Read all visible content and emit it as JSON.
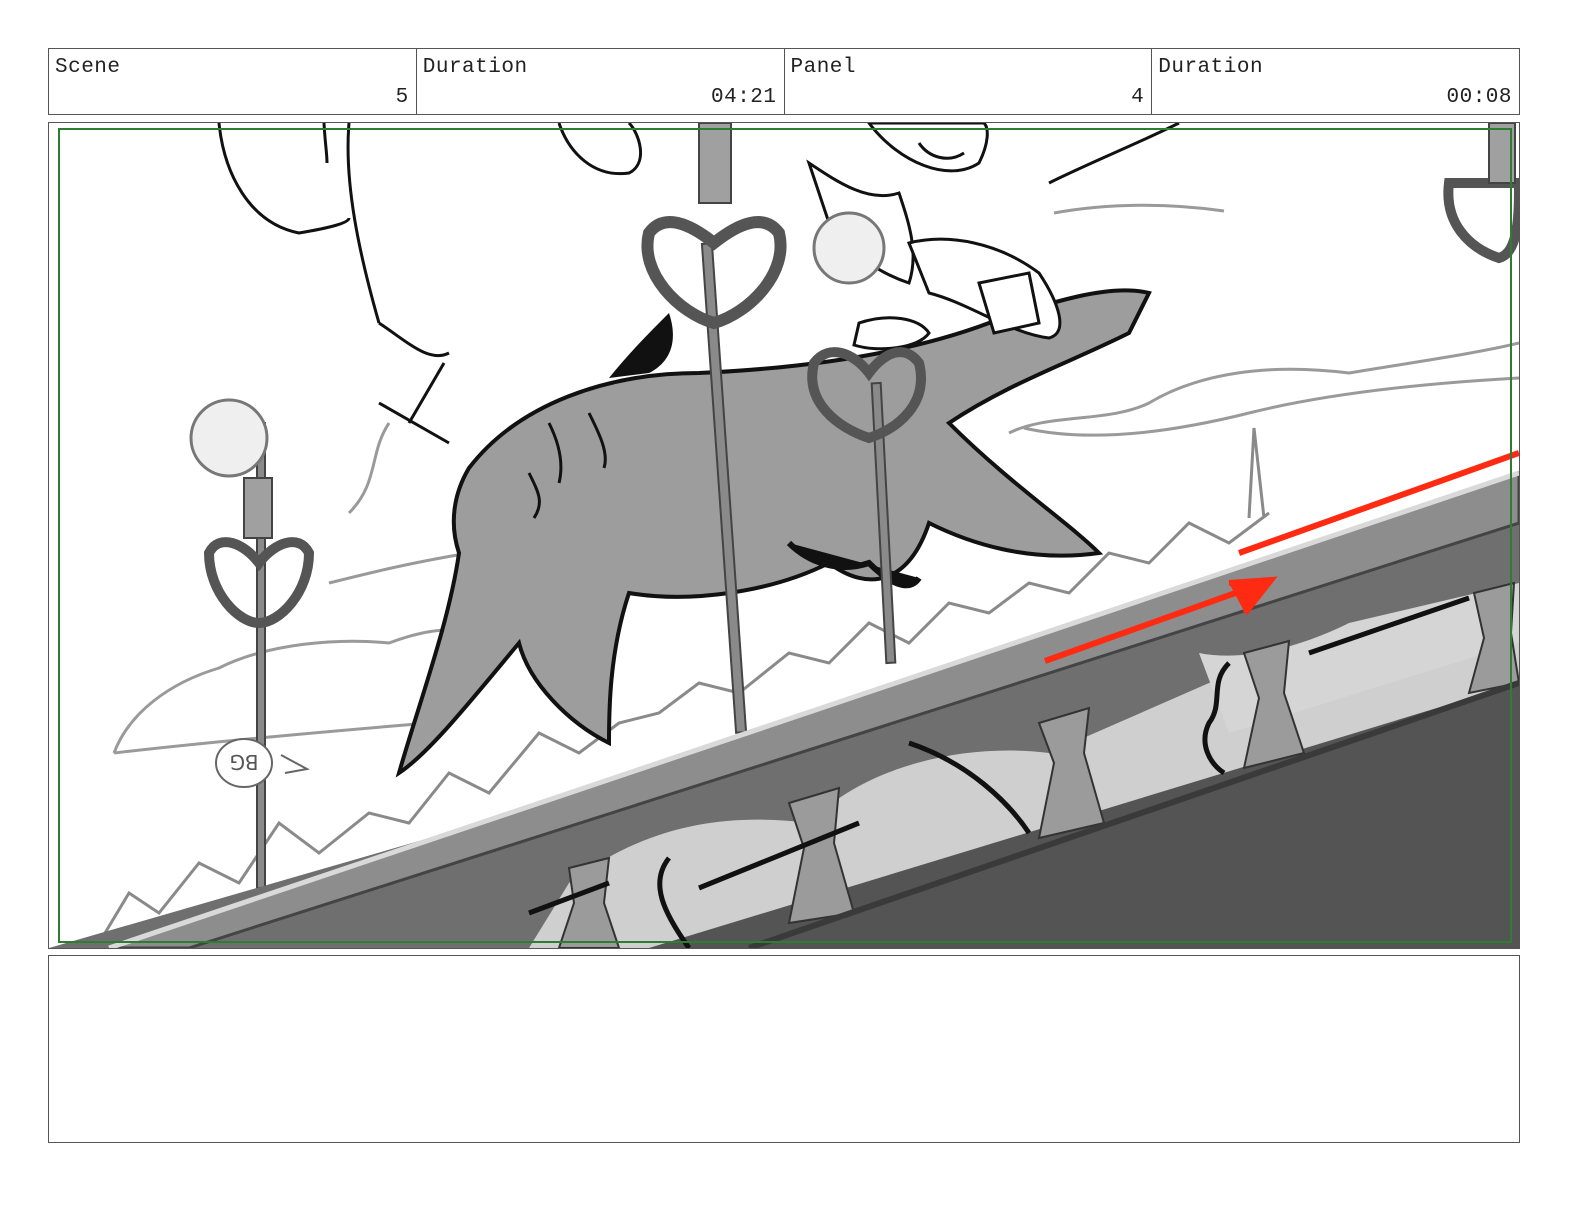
{
  "header": {
    "scene_label": "Scene",
    "scene_value": "5",
    "scene_duration_label": "Duration",
    "scene_duration_value": "04:21",
    "panel_label": "Panel",
    "panel_value": "4",
    "panel_duration_label": "Duration",
    "panel_duration_value": "00:08"
  },
  "panel_art": {
    "safe_area_color": "#2e7d32",
    "annotation_color": "#ff2a12",
    "icons": [
      "camera-move-arrow-icon",
      "bg-marker-icon"
    ],
    "bg_marker_text": "BG"
  },
  "notes": {
    "text": ""
  }
}
